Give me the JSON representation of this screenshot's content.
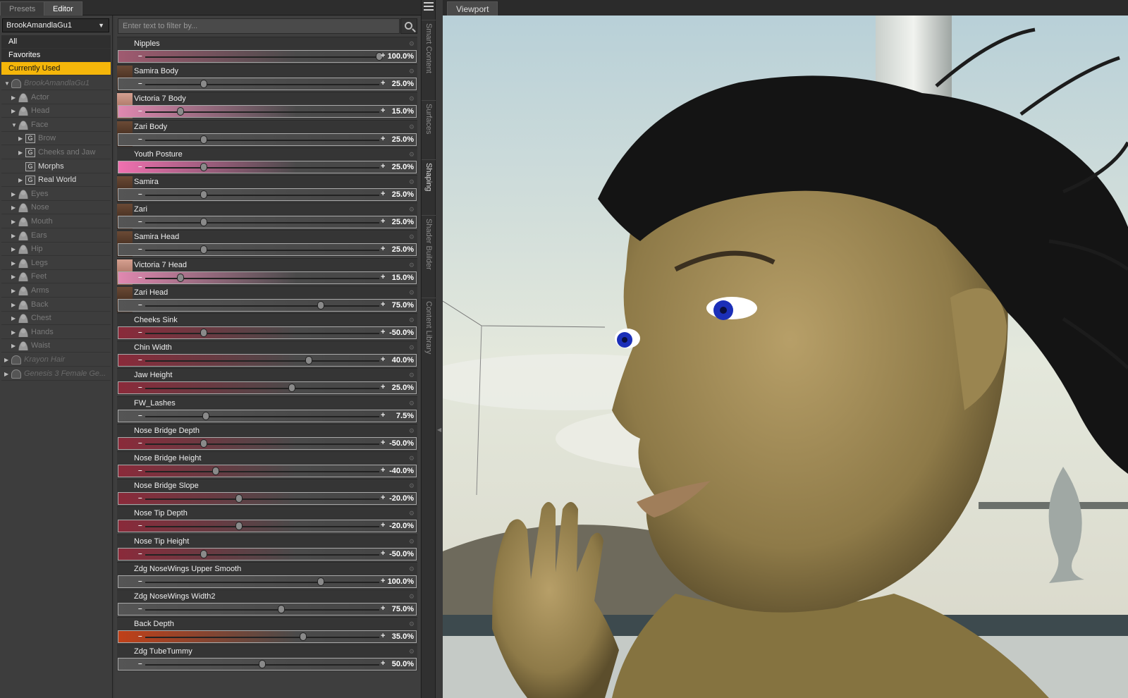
{
  "tabs": [
    {
      "label": "Presets"
    },
    {
      "label": "Editor"
    }
  ],
  "node_selector": {
    "value": "BrookAmandlaGu1"
  },
  "categories": [
    {
      "label": "All"
    },
    {
      "label": "Favorites"
    },
    {
      "label": "Currently Used"
    }
  ],
  "tree": [
    {
      "label": "BrookAmandlaGu1"
    },
    {
      "label": "Actor"
    },
    {
      "label": "Head"
    },
    {
      "label": "Face"
    },
    {
      "label": "Brow"
    },
    {
      "label": "Cheeks and Jaw"
    },
    {
      "label": "Morphs"
    },
    {
      "label": "Real World"
    },
    {
      "label": "Eyes"
    },
    {
      "label": "Nose"
    },
    {
      "label": "Mouth"
    },
    {
      "label": "Ears"
    },
    {
      "label": "Hip"
    },
    {
      "label": "Legs"
    },
    {
      "label": "Feet"
    },
    {
      "label": "Arms"
    },
    {
      "label": "Back"
    },
    {
      "label": "Chest"
    },
    {
      "label": "Hands"
    },
    {
      "label": "Waist"
    },
    {
      "label": "Krayon Hair"
    },
    {
      "label": "Genesis 3 Female Ge..."
    }
  ],
  "filter": {
    "placeholder": "Enter text to filter by..."
  },
  "sliders": [
    {
      "label": "Nipples",
      "value": "100.0%",
      "fraction": 1.0,
      "color": "#a05a70"
    },
    {
      "label": "Samira Body",
      "value": "25.0%",
      "fraction": 0.25,
      "color": "#555555"
    },
    {
      "label": "Victoria 7 Body",
      "value": "15.0%",
      "fraction": 0.15,
      "color": "#e088b0"
    },
    {
      "label": "Zari Body",
      "value": "25.0%",
      "fraction": 0.25,
      "color": "#555555"
    },
    {
      "label": "Youth Posture",
      "value": "25.0%",
      "fraction": 0.25,
      "color": "#f070b0"
    },
    {
      "label": "Samira",
      "value": "25.0%",
      "fraction": 0.25,
      "color": "#555555"
    },
    {
      "label": "Zari",
      "value": "25.0%",
      "fraction": 0.25,
      "color": "#555555"
    },
    {
      "label": "Samira Head",
      "value": "25.0%",
      "fraction": 0.25,
      "color": "#555555"
    },
    {
      "label": "Victoria 7 Head",
      "value": "15.0%",
      "fraction": 0.15,
      "color": "#e088b0"
    },
    {
      "label": "Zari Head",
      "value": "75.0%",
      "fraction": 0.75,
      "color": "#555555"
    },
    {
      "label": "Cheeks Sink",
      "value": "-50.0%",
      "fraction": 0.25,
      "color": "#8a2a3a"
    },
    {
      "label": "Chin Width",
      "value": "40.0%",
      "fraction": 0.7,
      "color": "#8a2a3a"
    },
    {
      "label": "Jaw Height",
      "value": "25.0%",
      "fraction": 0.625,
      "color": "#8a2a3a"
    },
    {
      "label": "FW_Lashes",
      "value": "7.5%",
      "fraction": 0.26,
      "color": "#555555"
    },
    {
      "label": "Nose Bridge Depth",
      "value": "-50.0%",
      "fraction": 0.25,
      "color": "#8a2a3a"
    },
    {
      "label": "Nose Bridge Height",
      "value": "-40.0%",
      "fraction": 0.3,
      "color": "#8a2a3a"
    },
    {
      "label": "Nose Bridge Slope",
      "value": "-20.0%",
      "fraction": 0.4,
      "color": "#8a2a3a"
    },
    {
      "label": "Nose Tip Depth",
      "value": "-20.0%",
      "fraction": 0.4,
      "color": "#8a2a3a"
    },
    {
      "label": "Nose Tip Height",
      "value": "-50.0%",
      "fraction": 0.25,
      "color": "#8a2a3a"
    },
    {
      "label": "Zdg NoseWings Upper Smooth",
      "value": "100.0%",
      "fraction": 0.75,
      "color": "#555555"
    },
    {
      "label": "Zdg NoseWings Width2",
      "value": "75.0%",
      "fraction": 0.58,
      "color": "#555555"
    },
    {
      "label": "Back Depth",
      "value": "35.0%",
      "fraction": 0.675,
      "color": "#c04018"
    },
    {
      "label": "Zdg TubeTummy",
      "value": "50.0%",
      "fraction": 0.5,
      "color": "#555555"
    }
  ],
  "side_tabs": [
    {
      "label": "Smart Content"
    },
    {
      "label": "Surfaces"
    },
    {
      "label": "Shaping"
    },
    {
      "label": "Shader Builder"
    },
    {
      "label": "Content Library"
    }
  ],
  "viewport": {
    "tab_label": "Viewport"
  }
}
